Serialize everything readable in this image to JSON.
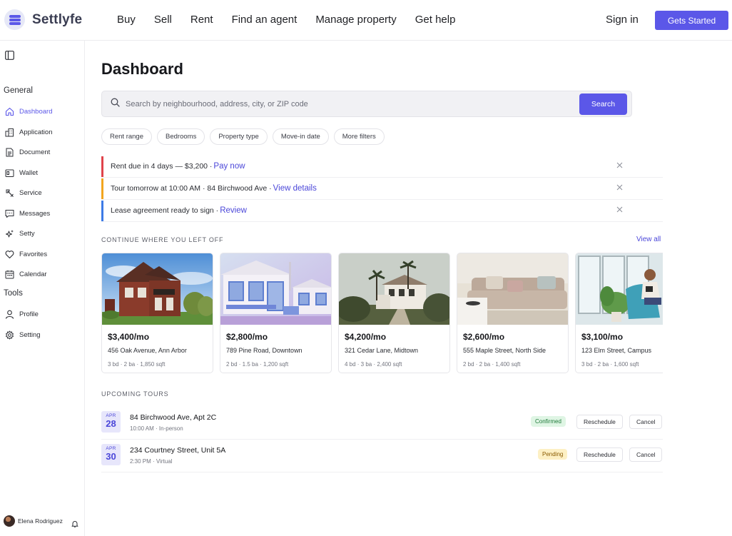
{
  "brand": {
    "name": "Settlyfe"
  },
  "nav": [
    "Buy",
    "Sell",
    "Rent",
    "Find an agent",
    "Manage property",
    "Get help"
  ],
  "auth": {
    "signin": "Sign in",
    "cta": "Gets Started"
  },
  "sidebar": {
    "general_label": "General",
    "tools_label": "Tools",
    "general": [
      {
        "label": "Dashboard",
        "icon": "home-icon"
      },
      {
        "label": "Application",
        "icon": "building-icon"
      },
      {
        "label": "Document",
        "icon": "document-icon"
      },
      {
        "label": "Wallet",
        "icon": "wallet-icon"
      },
      {
        "label": "Service",
        "icon": "service-icon"
      },
      {
        "label": "Messages",
        "icon": "messages-icon"
      },
      {
        "label": "Setty",
        "icon": "sparkle-icon"
      },
      {
        "label": "Favorites",
        "icon": "heart-icon"
      },
      {
        "label": "Calendar",
        "icon": "calendar-icon"
      }
    ],
    "tools": [
      {
        "label": "Profile",
        "icon": "user-icon"
      },
      {
        "label": "Setting",
        "icon": "gear-icon"
      }
    ],
    "user": "Elena Rodriguez"
  },
  "main": {
    "title": "Dashboard",
    "search": {
      "placeholder": "Search by neighbourhood, address, city, or ZIP code",
      "button": "Search"
    },
    "filters": [
      "Rent range",
      "Bedrooms",
      "Property type",
      "Move-in date",
      "More filters"
    ],
    "alerts": [
      {
        "text": "Rent due in 4 days — $3,200 ·",
        "link": "Pay now",
        "color": "#e0434b"
      },
      {
        "text": "Tour tomorrow at 10:00 AM · 84 Birchwood Ave ·",
        "link": "View details",
        "color": "#f2a51f"
      },
      {
        "text": "Lease agreement ready to sign ·",
        "link": "Review",
        "color": "#3d7be6"
      }
    ],
    "continue_label": "CONTINUE WHERE YOU LEFT OFF",
    "view_all": "View all",
    "listings": [
      {
        "price": "$3,400/mo",
        "address": "456 Oak Avenue, Ann Arbor",
        "meta": "3 bd · 2 ba · 1,850 sqft"
      },
      {
        "price": "$2,800/mo",
        "address": "789 Pine Road, Downtown",
        "meta": "2 bd · 1.5 ba · 1,200 sqft"
      },
      {
        "price": "$4,200/mo",
        "address": "321 Cedar Lane, Midtown",
        "meta": "4 bd · 3 ba · 2,400 sqft"
      },
      {
        "price": "$2,600/mo",
        "address": "555 Maple Street, North Side",
        "meta": "2 bd · 2 ba · 1,400 sqft"
      },
      {
        "price": "$3,100/mo",
        "address": "123 Elm Street, Campus",
        "meta": "3 bd · 2 ba · 1,600 sqft"
      }
    ],
    "tours_label": "UPCOMING TOURS",
    "tours": [
      {
        "month": "APR",
        "day": "28",
        "title": "84 Birchwood Ave, Apt 2C",
        "sub": "10:00 AM · In-person",
        "status": "Confirmed",
        "reschedule": "Reschedule",
        "cancel": "Cancel"
      },
      {
        "month": "APR",
        "day": "30",
        "title": "234 Courtney Street, Unit 5A",
        "sub": "2:30 PM · Virtual",
        "status": "Pending",
        "reschedule": "Reschedule",
        "cancel": "Cancel"
      }
    ]
  },
  "colors": {
    "accent": "#5b57e8",
    "confirmed_bg": "#dff5e4",
    "confirmed_fg": "#1f7a3a",
    "pending_bg": "#fdf0c4",
    "pending_fg": "#8a5a00"
  }
}
